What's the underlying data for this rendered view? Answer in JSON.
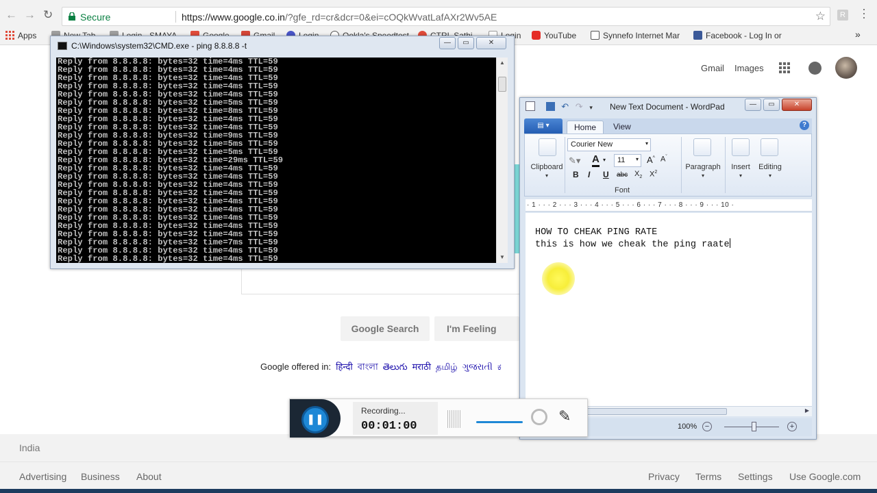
{
  "browser": {
    "secure_label": "Secure",
    "url_prefix": "https://www.google.co.in",
    "url_rest": "/?gfe_rd=cr&dcr=0&ei=cOQkWvatLafAXr2Wv5AE",
    "ext_letter": "R"
  },
  "bookmarks": {
    "apps": "Apps",
    "items": [
      {
        "label": "New Tab",
        "color": "#9e9e9e"
      },
      {
        "label": "Login - SMAYA",
        "color": "#9e9e9e"
      },
      {
        "label": "Google",
        "color": "#e04b3a"
      },
      {
        "label": "Gmail",
        "color": "#d44638"
      },
      {
        "label": "Login",
        "color": "#4a56c8"
      },
      {
        "label": "Ookla's Speedtest",
        "color": "#555555"
      },
      {
        "label": "CTRL Sathi",
        "color": "#e04b3a"
      },
      {
        "label": "Login",
        "color": "#9e9e9e"
      },
      {
        "label": "YouTube",
        "color": "#e52d27"
      },
      {
        "label": "Synnefo Internet Mar",
        "color": "#555555"
      },
      {
        "label": "Facebook - Log In or",
        "color": "#3b5998"
      }
    ],
    "more": "»"
  },
  "google": {
    "gmail": "Gmail",
    "images": "Images",
    "search_btn": "Google Search",
    "lucky_btn": "I'm Feeling Luck",
    "offered_label": "Google offered in:",
    "languages": [
      "हिन्दी",
      "বাংলা",
      "తెలుగు",
      "मराठी",
      "தமிழ்",
      "ગુજરાતી",
      "ಕ"
    ],
    "country": "India",
    "footer_left": [
      "Advertising",
      "Business",
      "About"
    ],
    "footer_right": [
      "Privacy",
      "Terms",
      "Settings",
      "Use Google.com"
    ]
  },
  "cmd": {
    "title": "C:\\Windows\\system32\\CMD.exe - ping  8.8.8.8 -t",
    "lines": [
      "Reply from 8.8.8.8: bytes=32 time=4ms TTL=59",
      "Reply from 8.8.8.8: bytes=32 time=4ms TTL=59",
      "Reply from 8.8.8.8: bytes=32 time=4ms TTL=59",
      "Reply from 8.8.8.8: bytes=32 time=4ms TTL=59",
      "Reply from 8.8.8.8: bytes=32 time=4ms TTL=59",
      "Reply from 8.8.8.8: bytes=32 time=5ms TTL=59",
      "Reply from 8.8.8.8: bytes=32 time=8ms TTL=59",
      "Reply from 8.8.8.8: bytes=32 time=4ms TTL=59",
      "Reply from 8.8.8.8: bytes=32 time=4ms TTL=59",
      "Reply from 8.8.8.8: bytes=32 time=9ms TTL=59",
      "Reply from 8.8.8.8: bytes=32 time=5ms TTL=59",
      "Reply from 8.8.8.8: bytes=32 time=5ms TTL=59",
      "Reply from 8.8.8.8: bytes=32 time=29ms TTL=59",
      "Reply from 8.8.8.8: bytes=32 time=4ms TTL=59",
      "Reply from 8.8.8.8: bytes=32 time=4ms TTL=59",
      "Reply from 8.8.8.8: bytes=32 time=4ms TTL=59",
      "Reply from 8.8.8.8: bytes=32 time=4ms TTL=59",
      "Reply from 8.8.8.8: bytes=32 time=4ms TTL=59",
      "Reply from 8.8.8.8: bytes=32 time=4ms TTL=59",
      "Reply from 8.8.8.8: bytes=32 time=4ms TTL=59",
      "Reply from 8.8.8.8: bytes=32 time=4ms TTL=59",
      "Reply from 8.8.8.8: bytes=32 time=4ms TTL=59",
      "Reply from 8.8.8.8: bytes=32 time=7ms TTL=59",
      "Reply from 8.8.8.8: bytes=32 time=4ms TTL=59",
      "Reply from 8.8.8.8: bytes=32 time=4ms TTL=59"
    ]
  },
  "wordpad": {
    "title": "New Text Document - WordPad",
    "tabs": [
      "Home",
      "View"
    ],
    "font_name": "Courier New",
    "font_size": "11",
    "groups": {
      "clipboard": "Clipboard",
      "font": "Font",
      "paragraph": "Paragraph",
      "insert": "Insert",
      "editing": "Editing"
    },
    "ruler": "· 1 · · · 2 · · · 3 · · · 4 · · · 5 · · · 6 · · · 7 · · · 8 · · · 9 · · · 10 ·",
    "doc_lines": [
      "HOW TO CHEAK PING RATE",
      "this is how we cheak the ping raate"
    ],
    "zoom": "100%"
  },
  "recorder": {
    "status": "Recording...",
    "time": "00:01:00"
  }
}
